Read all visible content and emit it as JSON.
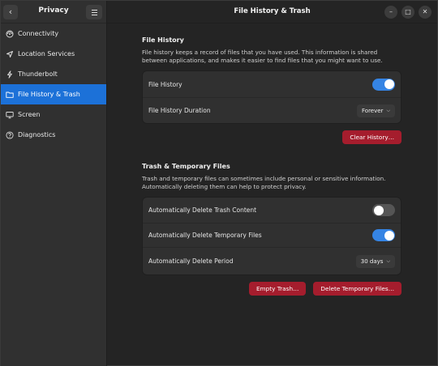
{
  "sidebar": {
    "title": "Privacy",
    "back_glyph": "‹",
    "items": [
      {
        "label": "Connectivity",
        "icon": "connectivity-icon",
        "active": false
      },
      {
        "label": "Location Services",
        "icon": "location-icon",
        "active": false
      },
      {
        "label": "Thunderbolt",
        "icon": "thunderbolt-icon",
        "active": false
      },
      {
        "label": "File History & Trash",
        "icon": "folder-icon",
        "active": true
      },
      {
        "label": "Screen",
        "icon": "screen-icon",
        "active": false
      },
      {
        "label": "Diagnostics",
        "icon": "diagnostics-icon",
        "active": false
      }
    ]
  },
  "header": {
    "title": "File History & Trash",
    "min_glyph": "–",
    "max_glyph": "□",
    "close_glyph": "✕"
  },
  "file_history": {
    "title": "File History",
    "description": "File history keeps a record of files that you have used. This information is shared between applications, and makes it easier to find files that you might want to use.",
    "toggle_label": "File History",
    "toggle_on": true,
    "duration_label": "File History Duration",
    "duration_value": "Forever",
    "clear_button": "Clear History…"
  },
  "trash": {
    "title": "Trash & Temporary Files",
    "description": "Trash and temporary files can sometimes include personal or sensitive information. Automatically deleting them can help to protect privacy.",
    "auto_trash_label": "Automatically Delete Trash Content",
    "auto_trash_on": false,
    "auto_temp_label": "Automatically Delete Temporary Files",
    "auto_temp_on": true,
    "period_label": "Automatically Delete Period",
    "period_value": "30 days",
    "empty_button": "Empty Trash…",
    "delete_temp_button": "Delete Temporary Files…"
  },
  "colors": {
    "accent": "#3584e4",
    "selection": "#1c71d8",
    "destructive": "#a51d2d"
  }
}
